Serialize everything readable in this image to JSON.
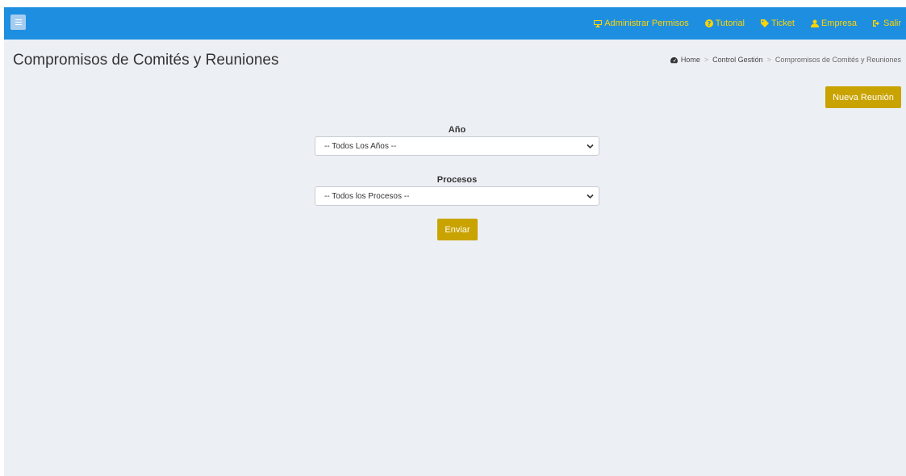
{
  "navbar": {
    "menu_icon": "bars-icon",
    "links": [
      {
        "label": "Administrar Permisos",
        "icon": "desktop-icon"
      },
      {
        "label": "Tutorial",
        "icon": "question-circle-icon"
      },
      {
        "label": "Ticket",
        "icon": "tag-icon"
      },
      {
        "label": "Empresa",
        "icon": "user-icon"
      },
      {
        "label": "Salir",
        "icon": "sign-out-icon"
      }
    ],
    "bg_color": "#1e8fe0",
    "link_color": "#ffd400"
  },
  "header": {
    "title": "Compromisos de Comités y Reuniones",
    "breadcrumb": [
      {
        "label": "Home",
        "icon": "tachometer-icon"
      },
      {
        "label": "Control Gestión"
      },
      {
        "label": "Compromisos de Comités y Reuniones"
      }
    ]
  },
  "actions": {
    "new_meeting_label": "Nueva Reunión",
    "accent_color": "#c9a300"
  },
  "form": {
    "year_label": "Año",
    "year_value": "-- Todos Los Años --",
    "process_label": "Procesos",
    "process_value": "-- Todos los Procesos --",
    "submit_label": "Enviar"
  }
}
